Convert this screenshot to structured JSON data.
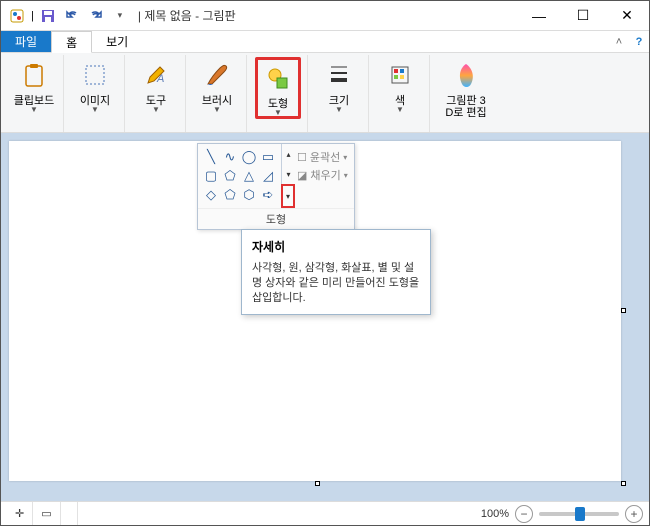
{
  "title": "제목 없음 - 그림판",
  "title_sep": "|",
  "qat": {
    "save_name": "save-icon",
    "undo_name": "undo-icon",
    "redo_name": "redo-icon"
  },
  "tabs": {
    "file": "파일",
    "home": "홈",
    "view": "보기"
  },
  "ribbon": {
    "clipboard": "클립보드",
    "image": "이미지",
    "tools": "도구",
    "brush": "브러시",
    "shapes": "도형",
    "size": "크기",
    "colors": "색",
    "paint3d_line1": "그림판 3",
    "paint3d_line2": "D로 편집"
  },
  "popup": {
    "outline": "윤곽선",
    "fill": "채우기",
    "footer": "도형"
  },
  "tooltip": {
    "title": "자세히",
    "body": "사각형, 원, 삼각형, 화살표, 별 및 설명 상자와 같은 미리 만들어진 도형을 삽입합니다."
  },
  "status": {
    "coord_icon": "✛",
    "select_icon": "▭",
    "zoom_pct": "100%"
  }
}
